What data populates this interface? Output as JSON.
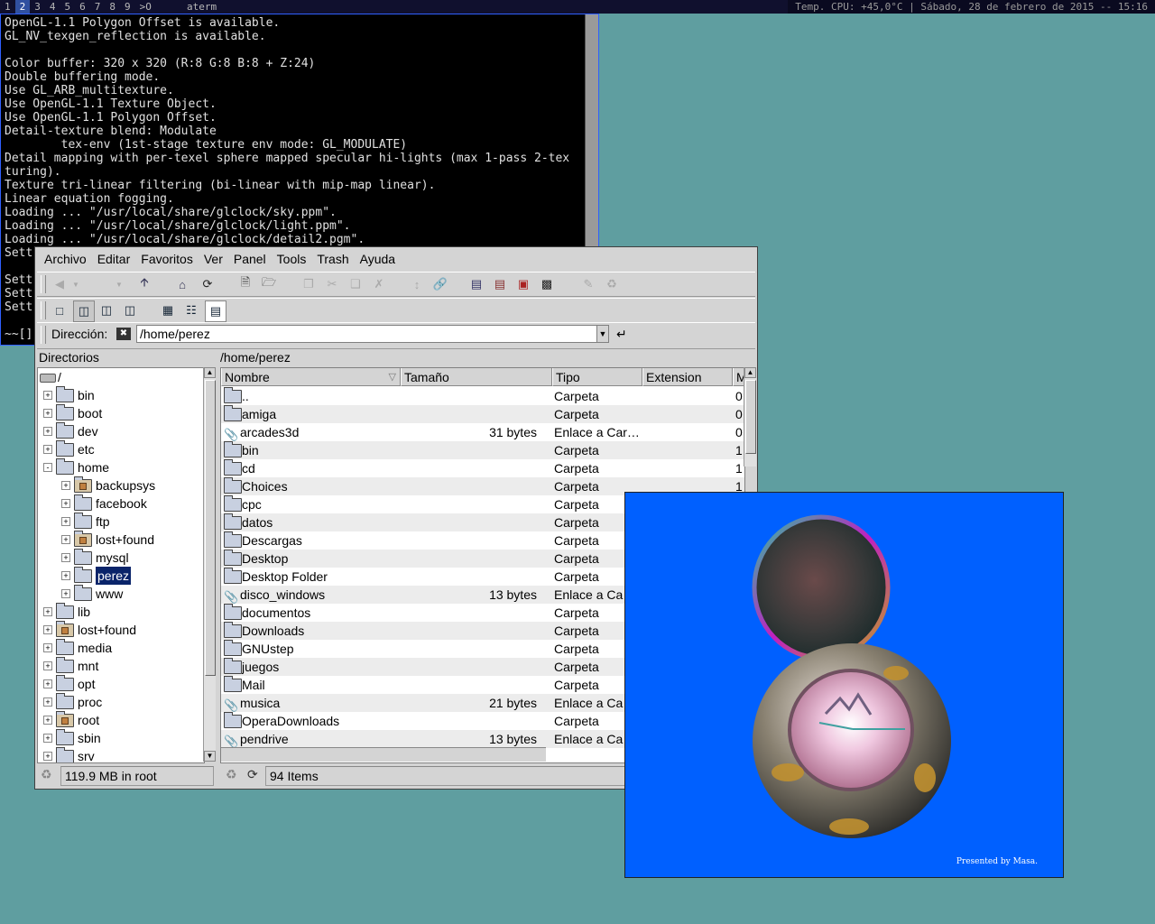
{
  "top_panel": {
    "desktops": [
      "1",
      "2",
      "3",
      "4",
      "5",
      "6",
      "7",
      "8",
      "9"
    ],
    "current_desktop": "2",
    "switcher_glyph": ">O",
    "window_title": "aterm",
    "tray_text": "Temp. CPU: +45,0°C  |  Sábado, 28 de febrero de 2015 -- 15:16"
  },
  "terminal": {
    "title": "aterm",
    "lines": [
      "OpenGL-1.1 Polygon Offset is available.",
      "GL_NV_texgen_reflection is available.",
      "",
      "Color buffer: 320 x 320 (R:8 G:8 B:8 + Z:24)",
      "Double buffering mode.",
      "Use GL_ARB_multitexture.",
      "Use OpenGL-1.1 Texture Object.",
      "Use OpenGL-1.1 Polygon Offset.",
      "Detail-texture blend: Modulate",
      "        tex-env (1st-stage texture env mode: GL_MODULATE)",
      "Detail mapping with per-texel sphere mapped specular hi-lights (max 1-pass 2-tex",
      "turing).",
      "Texture tri-linear filtering (bi-linear with mip-map linear).",
      "Linear equation fogging.",
      "Loading ... \"/usr/local/share/glclock/sky.ppm\".",
      "Loading ... \"/usr/local/share/glclock/light.ppm\".",
      "Loading ... \"/usr/local/share/glclock/detail2.pgm\".",
      "Sett",
      "",
      "Sett",
      "Sett",
      "Sett",
      "",
      "~~[]"
    ]
  },
  "file_manager": {
    "menu": [
      "Archivo",
      "Editar",
      "Favoritos",
      "Ver",
      "Panel",
      "Tools",
      "Trash",
      "Ayuda"
    ],
    "address_label": "Dirección:",
    "address_value": "/home/perez",
    "dir_header": "Directorios",
    "path_header": "/home/perez",
    "tree": [
      {
        "label": "/",
        "depth": 0,
        "exp": "",
        "icon": "drive",
        "selected": false
      },
      {
        "label": "bin",
        "depth": 1,
        "exp": "+",
        "icon": "folder",
        "selected": false
      },
      {
        "label": "boot",
        "depth": 1,
        "exp": "+",
        "icon": "folder",
        "selected": false
      },
      {
        "label": "dev",
        "depth": 1,
        "exp": "+",
        "icon": "folder",
        "selected": false
      },
      {
        "label": "etc",
        "depth": 1,
        "exp": "+",
        "icon": "folder",
        "selected": false
      },
      {
        "label": "home",
        "depth": 1,
        "exp": "-",
        "icon": "open",
        "selected": false
      },
      {
        "label": "backupsys",
        "depth": 2,
        "exp": "+",
        "icon": "lock",
        "selected": false
      },
      {
        "label": "facebook",
        "depth": 2,
        "exp": "+",
        "icon": "folder",
        "selected": false
      },
      {
        "label": "ftp",
        "depth": 2,
        "exp": "+",
        "icon": "folder",
        "selected": false
      },
      {
        "label": "lost+found",
        "depth": 2,
        "exp": "+",
        "icon": "lock",
        "selected": false
      },
      {
        "label": "mysql",
        "depth": 2,
        "exp": "+",
        "icon": "folder",
        "selected": false
      },
      {
        "label": "perez",
        "depth": 2,
        "exp": "+",
        "icon": "folder",
        "selected": true
      },
      {
        "label": "www",
        "depth": 2,
        "exp": "+",
        "icon": "folder",
        "selected": false
      },
      {
        "label": "lib",
        "depth": 1,
        "exp": "+",
        "icon": "folder",
        "selected": false
      },
      {
        "label": "lost+found",
        "depth": 1,
        "exp": "+",
        "icon": "lock",
        "selected": false
      },
      {
        "label": "media",
        "depth": 1,
        "exp": "+",
        "icon": "folder",
        "selected": false
      },
      {
        "label": "mnt",
        "depth": 1,
        "exp": "+",
        "icon": "folder",
        "selected": false
      },
      {
        "label": "opt",
        "depth": 1,
        "exp": "+",
        "icon": "folder",
        "selected": false
      },
      {
        "label": "proc",
        "depth": 1,
        "exp": "+",
        "icon": "folder",
        "selected": false
      },
      {
        "label": "root",
        "depth": 1,
        "exp": "+",
        "icon": "lock",
        "selected": false
      },
      {
        "label": "sbin",
        "depth": 1,
        "exp": "+",
        "icon": "folder",
        "selected": false
      },
      {
        "label": "srv",
        "depth": 1,
        "exp": "+",
        "icon": "folder",
        "selected": false
      }
    ],
    "columns": [
      "Nombre",
      "Tamaño",
      "Tipo",
      "Extension",
      "M"
    ],
    "files": [
      {
        "name": "..",
        "size": "",
        "type": "Carpeta",
        "ext": "",
        "m": "0",
        "icon": "up"
      },
      {
        "name": "amiga",
        "size": "",
        "type": "Carpeta",
        "ext": "",
        "m": "0",
        "icon": "folder"
      },
      {
        "name": "arcades3d",
        "size": "31 bytes",
        "type": "Enlace a Car…",
        "ext": "",
        "m": "0",
        "icon": "link"
      },
      {
        "name": "bin",
        "size": "",
        "type": "Carpeta",
        "ext": "",
        "m": "1",
        "icon": "folder"
      },
      {
        "name": "cd",
        "size": "",
        "type": "Carpeta",
        "ext": "",
        "m": "1",
        "icon": "folder"
      },
      {
        "name": "Choices",
        "size": "",
        "type": "Carpeta",
        "ext": "",
        "m": "1",
        "icon": "folder"
      },
      {
        "name": "cpc",
        "size": "",
        "type": "Carpeta",
        "ext": "",
        "m": "",
        "icon": "folder"
      },
      {
        "name": "datos",
        "size": "",
        "type": "Carpeta",
        "ext": "",
        "m": "",
        "icon": "folder"
      },
      {
        "name": "Descargas",
        "size": "",
        "type": "Carpeta",
        "ext": "",
        "m": "",
        "icon": "folder"
      },
      {
        "name": "Desktop",
        "size": "",
        "type": "Carpeta",
        "ext": "",
        "m": "",
        "icon": "folder"
      },
      {
        "name": "Desktop Folder",
        "size": "",
        "type": "Carpeta",
        "ext": "",
        "m": "",
        "icon": "folder"
      },
      {
        "name": "disco_windows",
        "size": "13 bytes",
        "type": "Enlace a Ca",
        "ext": "",
        "m": "",
        "icon": "link"
      },
      {
        "name": "documentos",
        "size": "",
        "type": "Carpeta",
        "ext": "",
        "m": "",
        "icon": "folder"
      },
      {
        "name": "Downloads",
        "size": "",
        "type": "Carpeta",
        "ext": "",
        "m": "",
        "icon": "folder"
      },
      {
        "name": "GNUstep",
        "size": "",
        "type": "Carpeta",
        "ext": "",
        "m": "",
        "icon": "folder"
      },
      {
        "name": "juegos",
        "size": "",
        "type": "Carpeta",
        "ext": "",
        "m": "",
        "icon": "folder"
      },
      {
        "name": "Mail",
        "size": "",
        "type": "Carpeta",
        "ext": "",
        "m": "",
        "icon": "folder"
      },
      {
        "name": "musica",
        "size": "21 bytes",
        "type": "Enlace a Ca",
        "ext": "",
        "m": "",
        "icon": "link"
      },
      {
        "name": "OperaDownloads",
        "size": "",
        "type": "Carpeta",
        "ext": "",
        "m": "",
        "icon": "folder"
      },
      {
        "name": "pendrive",
        "size": "13 bytes",
        "type": "Enlace a Ca",
        "ext": "",
        "m": "",
        "icon": "link"
      }
    ],
    "dir_status": "119.9 MB in root",
    "file_status": "94 Items"
  },
  "glclock": {
    "credit": "Presented by Masa."
  }
}
